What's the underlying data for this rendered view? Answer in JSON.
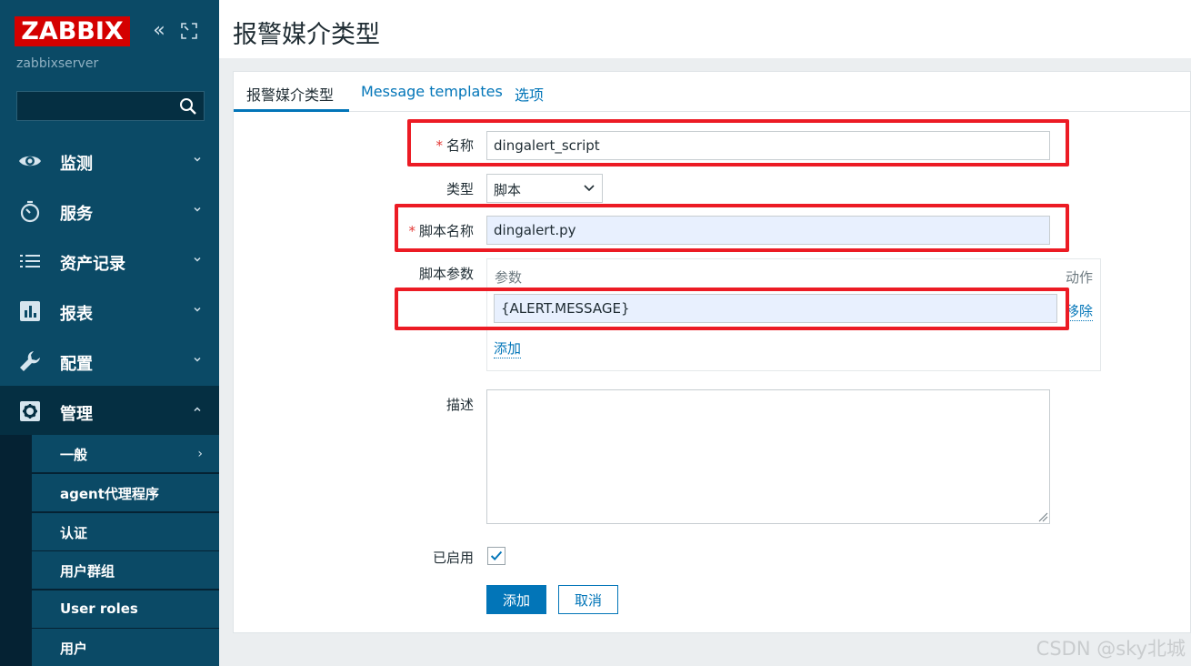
{
  "app": {
    "logo_text": "ZABBIX",
    "server_name": "zabbixserver",
    "page_title": "报警媒介类型",
    "brand_color": "#d40000",
    "sidebar_color": "#0b4a66",
    "accent_color": "#0275b8"
  },
  "sidebar": {
    "search": {
      "value": "",
      "placeholder": ""
    },
    "items": [
      {
        "label": "监测",
        "icon": "eye-icon"
      },
      {
        "label": "服务",
        "icon": "stopwatch-icon"
      },
      {
        "label": "资产记录",
        "icon": "list-icon"
      },
      {
        "label": "报表",
        "icon": "bar-chart-icon"
      },
      {
        "label": "配置",
        "icon": "wrench-icon"
      },
      {
        "label": "管理",
        "icon": "gear-icon"
      }
    ],
    "submenu": [
      {
        "label": "一般"
      },
      {
        "label": "agent代理程序"
      },
      {
        "label": "认证"
      },
      {
        "label": "用户群组"
      },
      {
        "label": "User roles"
      },
      {
        "label": "用户"
      }
    ]
  },
  "tabs": [
    {
      "label": "报警媒介类型",
      "active": true
    },
    {
      "label": "Message templates",
      "active": false
    },
    {
      "label": "选项",
      "active": false
    }
  ],
  "form": {
    "name_label": "名称",
    "name_value": "dingalert_script",
    "type_label": "类型",
    "type_value": "脚本",
    "script_name_label": "脚本名称",
    "script_name_value": "dingalert.py",
    "script_params_label": "脚本参数",
    "params_header": "参数",
    "action_header": "动作",
    "param_value": "{ALERT.MESSAGE}",
    "remove_label": "移除",
    "add_param_label": "添加",
    "description_label": "描述",
    "description_value": "",
    "enabled_label": "已启用",
    "enabled": true
  },
  "buttons": {
    "add_label": "添加",
    "cancel_label": "取消"
  },
  "watermark": "CSDN @sky北城"
}
